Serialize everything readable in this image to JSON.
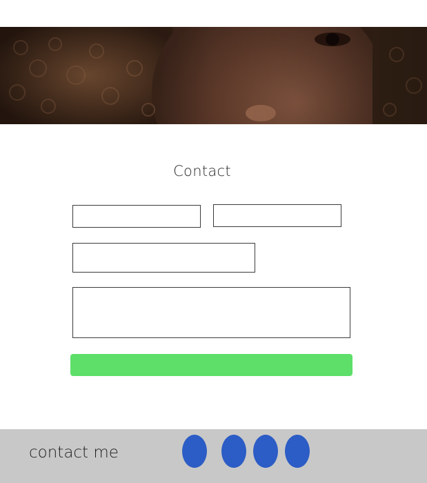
{
  "hero": {
    "image_description": "portrait"
  },
  "contact": {
    "title": "Contact"
  },
  "form": {
    "first_name_placeholder": "",
    "last_name_placeholder": "",
    "email_placeholder": "",
    "message_placeholder": "",
    "submit_label": ""
  },
  "footer": {
    "label": "contact me",
    "social_icons": [
      "social-icon",
      "social-icon",
      "social-icon",
      "social-icon"
    ]
  },
  "colors": {
    "submit_button": "#5ddf6a",
    "footer_background": "#c8c8c8",
    "social_icon": "#2c5cc5"
  }
}
